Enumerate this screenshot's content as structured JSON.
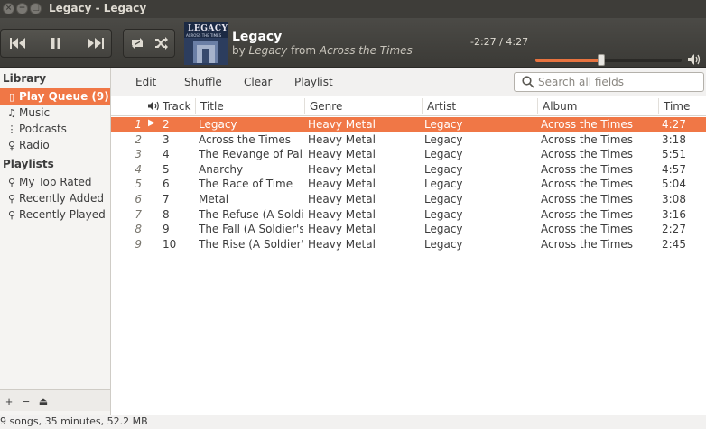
{
  "window": {
    "title": "Legacy - Legacy"
  },
  "player": {
    "track_title": "Legacy",
    "by_word": "by",
    "artist": "Legacy",
    "from_word": "from",
    "album": "Across the Times",
    "position": "-2:27 / 4:27",
    "progress_fraction": 0.45,
    "cover_text": "LEGACY",
    "cover_subtext": "ACROSS THE TIMES",
    "icons": {
      "prev": "previous-track-icon",
      "pause": "pause-icon",
      "next": "next-track-icon",
      "repeat": "repeat-icon",
      "shuffle": "shuffle-icon",
      "volume": "volume-icon"
    }
  },
  "sidebar": {
    "library_heading": "Library",
    "library_items": [
      {
        "label": "Play Queue (9)",
        "icon": "play-queue-icon",
        "active": true
      },
      {
        "label": "Music",
        "icon": "music-icon",
        "active": false
      },
      {
        "label": "Podcasts",
        "icon": "podcast-icon",
        "active": false
      },
      {
        "label": "Radio",
        "icon": "radio-icon",
        "active": false
      }
    ],
    "playlists_heading": "Playlists",
    "playlist_items": [
      {
        "label": "My Top Rated",
        "icon": "smart-playlist-icon"
      },
      {
        "label": "Recently Added",
        "icon": "smart-playlist-icon"
      },
      {
        "label": "Recently Played",
        "icon": "smart-playlist-icon"
      }
    ],
    "bottom_buttons": [
      "+",
      "−",
      "⏏"
    ]
  },
  "actions": {
    "edit": "Edit",
    "shuffle": "Shuffle",
    "clear": "Clear",
    "playlist": "Playlist"
  },
  "search": {
    "placeholder": "Search all fields"
  },
  "table": {
    "headers": {
      "track": "Track",
      "title": "Title",
      "genre": "Genre",
      "artist": "Artist",
      "album": "Album",
      "time": "Time"
    },
    "rows": [
      {
        "num": "1",
        "track": "2",
        "title": "Legacy",
        "genre": "Heavy Metal",
        "artist": "Legacy",
        "album": "Across the Times",
        "time": "4:27",
        "playing": true
      },
      {
        "num": "2",
        "track": "3",
        "title": "Across the Times",
        "genre": "Heavy Metal",
        "artist": "Legacy",
        "album": "Across the Times",
        "time": "3:18",
        "playing": false
      },
      {
        "num": "3",
        "track": "4",
        "title": "The Revange of Pallas",
        "genre": "Heavy Metal",
        "artist": "Legacy",
        "album": "Across the Times",
        "time": "5:51",
        "playing": false
      },
      {
        "num": "4",
        "track": "5",
        "title": "Anarchy",
        "genre": "Heavy Metal",
        "artist": "Legacy",
        "album": "Across the Times",
        "time": "4:57",
        "playing": false
      },
      {
        "num": "5",
        "track": "6",
        "title": "The Race of Time",
        "genre": "Heavy Metal",
        "artist": "Legacy",
        "album": "Across the Times",
        "time": "5:04",
        "playing": false
      },
      {
        "num": "6",
        "track": "7",
        "title": "Metal",
        "genre": "Heavy Metal",
        "artist": "Legacy",
        "album": "Across the Times",
        "time": "3:08",
        "playing": false
      },
      {
        "num": "7",
        "track": "8",
        "title": "The Refuse (A Soldie…",
        "genre": "Heavy Metal",
        "artist": "Legacy",
        "album": "Across the Times",
        "time": "3:16",
        "playing": false
      },
      {
        "num": "8",
        "track": "9",
        "title": "The Fall (A Soldier's …",
        "genre": "Heavy Metal",
        "artist": "Legacy",
        "album": "Across the Times",
        "time": "2:27",
        "playing": false
      },
      {
        "num": "9",
        "track": "10",
        "title": "The Rise (A Soldier'…",
        "genre": "Heavy Metal",
        "artist": "Legacy",
        "album": "Across the Times",
        "time": "2:45",
        "playing": false
      }
    ]
  },
  "status": {
    "summary": "9 songs, 35 minutes, 52.2 MB"
  },
  "colors": {
    "accent": "#f07746",
    "toolbar": "#3e3d39"
  }
}
